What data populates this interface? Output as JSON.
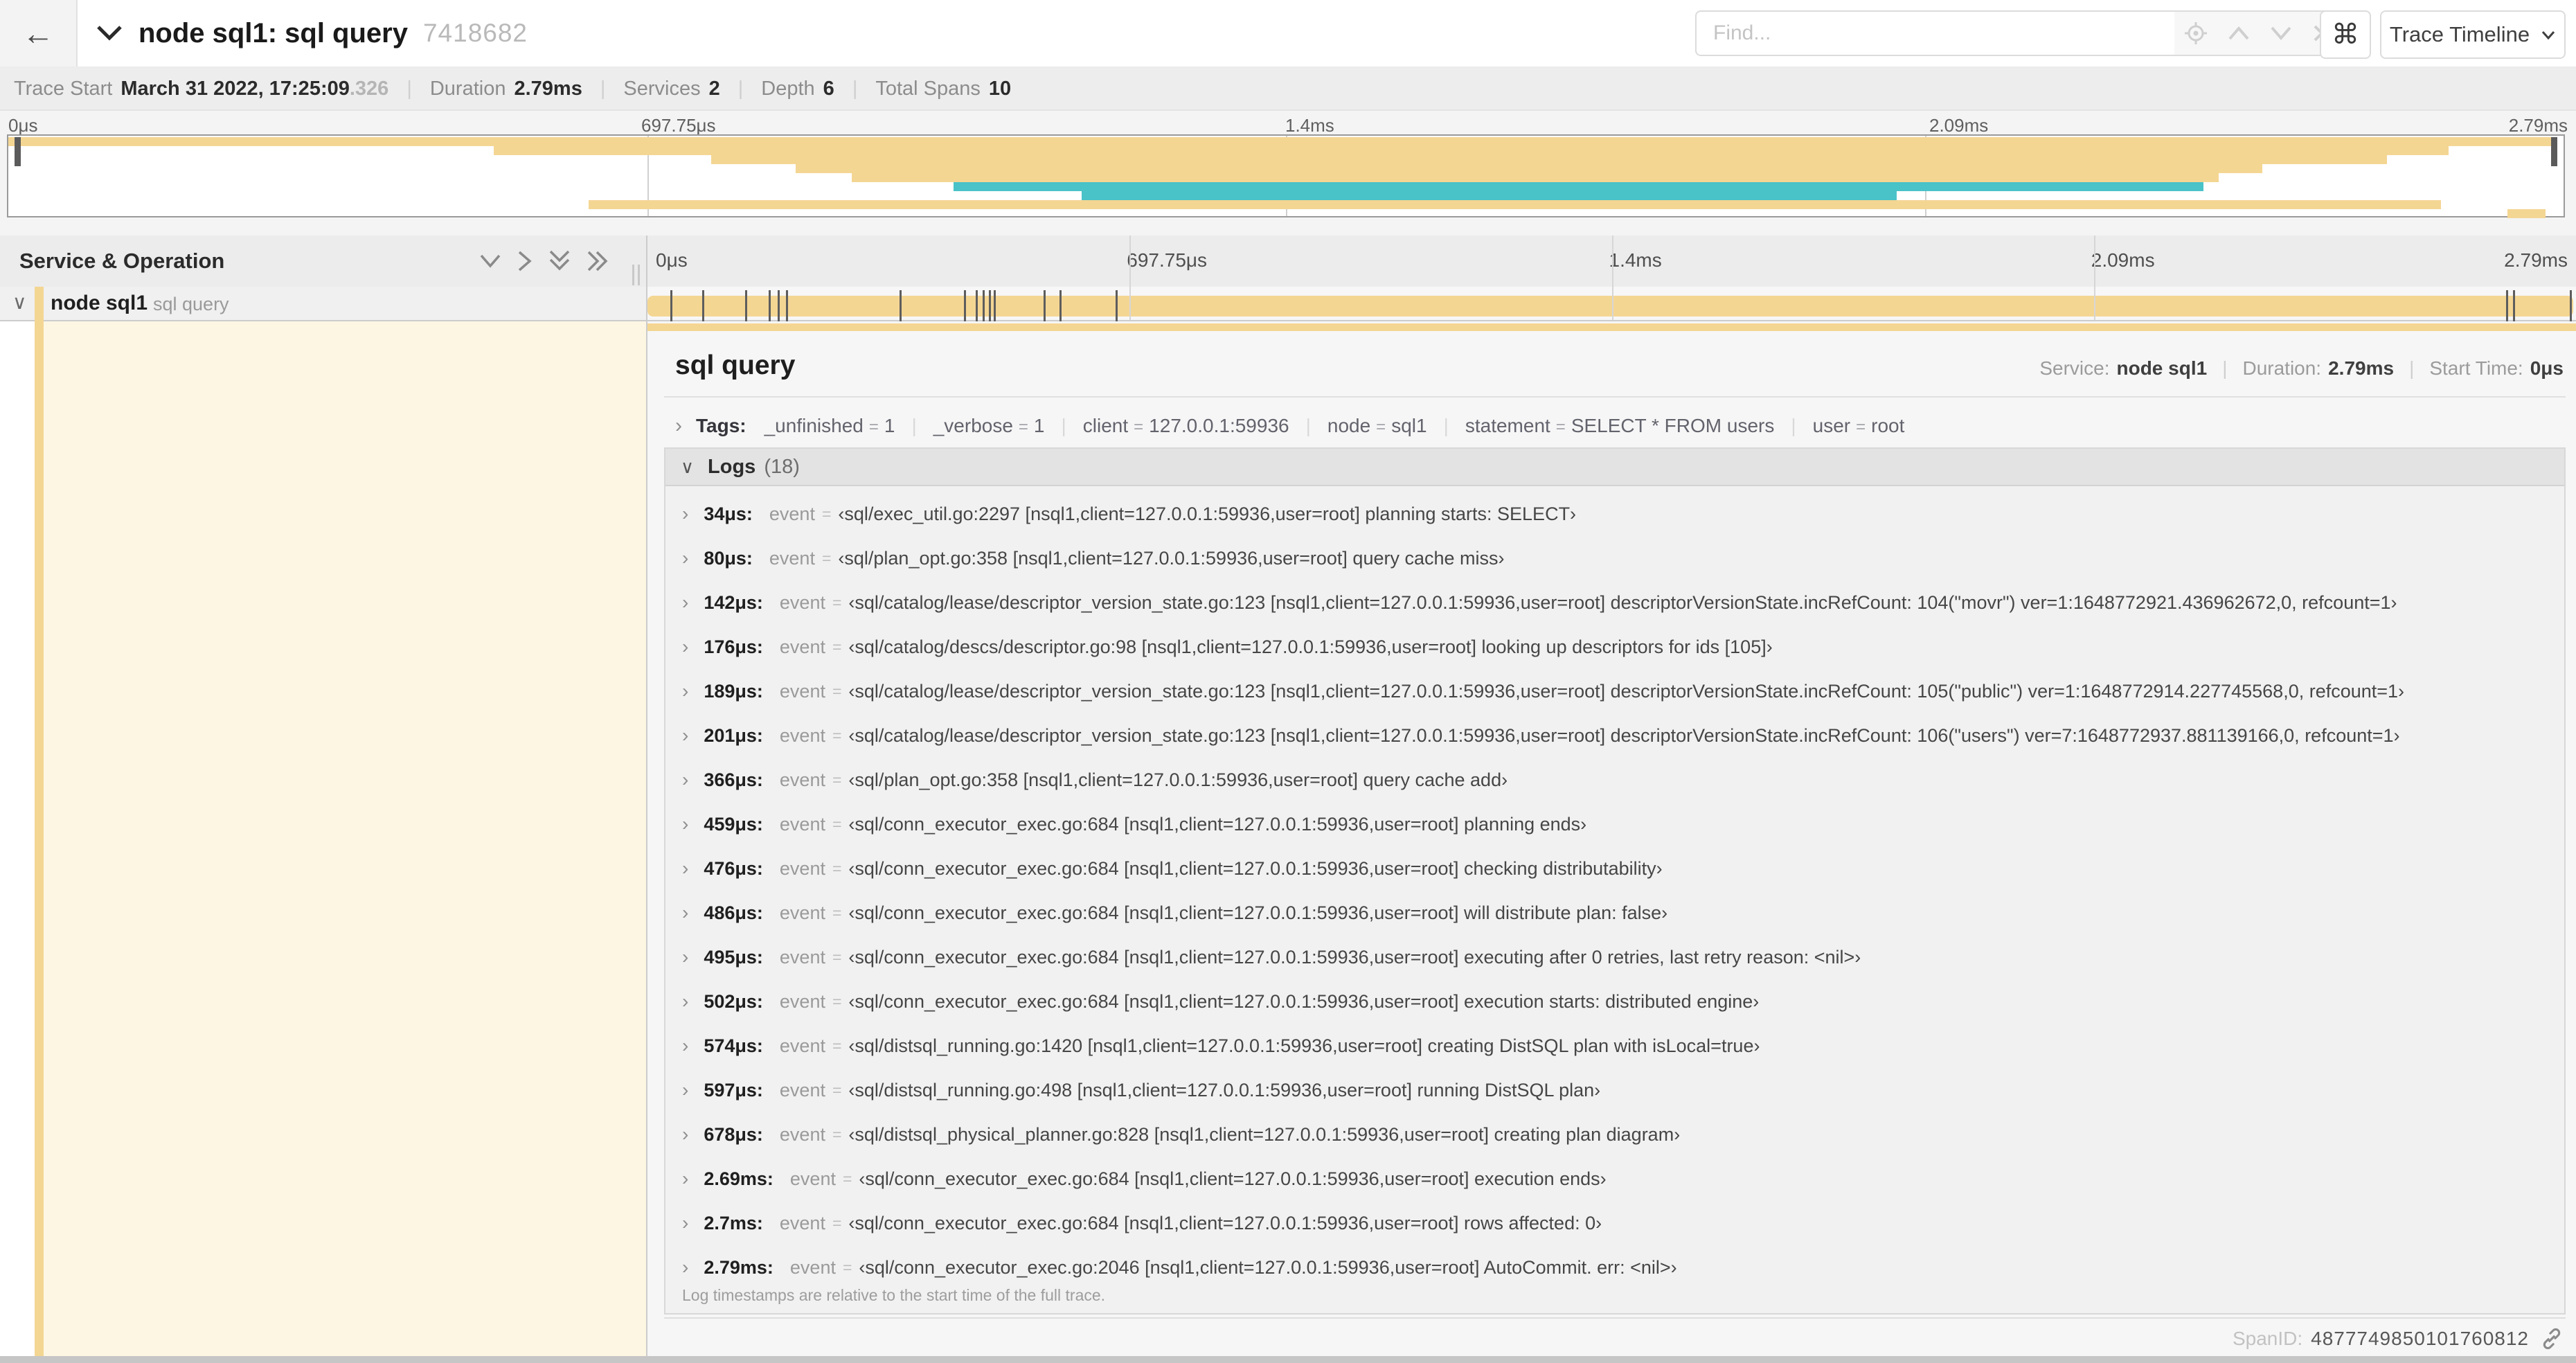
{
  "colors": {
    "accent_tan": "#f4d693",
    "teal": "#49c2c8",
    "cream_bg": "#fdf6e3"
  },
  "topbar": {
    "back_label": "←",
    "collapse_label": "∨",
    "title": "node sql1: sql query",
    "trace_id": "7418682",
    "find_placeholder": "Find...",
    "shortcut_label": "⌘",
    "view_selector": "Trace Timeline"
  },
  "trace_meta": {
    "items": [
      {
        "label": "Trace Start",
        "value": "March 31 2022, 17:25:09",
        "suffix": ".326"
      },
      {
        "label": "Duration",
        "value": "2.79ms"
      },
      {
        "label": "Services",
        "value": "2"
      },
      {
        "label": "Depth",
        "value": "6"
      },
      {
        "label": "Total Spans",
        "value": "10"
      }
    ]
  },
  "timeline": {
    "ticks": [
      "0μs",
      "697.75μs",
      "1.4ms",
      "2.09ms",
      "2.79ms"
    ],
    "duration_us": 2790,
    "gridlines_pct": [
      25,
      50,
      75
    ]
  },
  "minimap": {
    "spans": [
      {
        "r": 0,
        "s": 0,
        "e": 99.7,
        "c": "tan"
      },
      {
        "r": 1,
        "s": 19,
        "e": 95.5,
        "c": "tan"
      },
      {
        "r": 2,
        "s": 27.5,
        "e": 93.1,
        "c": "tan"
      },
      {
        "r": 3,
        "s": 30.8,
        "e": 88.2,
        "c": "tan"
      },
      {
        "r": 4,
        "s": 33,
        "e": 86.5,
        "c": "tan"
      },
      {
        "r": 5,
        "s": 37,
        "e": 85.9,
        "c": "teal"
      },
      {
        "r": 6,
        "s": 42,
        "e": 73.9,
        "c": "teal"
      },
      {
        "r": 7,
        "s": 22.7,
        "e": 95.2,
        "c": "tan"
      },
      {
        "r": 8,
        "s": 97.8,
        "e": 99.3,
        "c": "tan"
      }
    ]
  },
  "left_panel": {
    "header": "Service & Operation",
    "row": {
      "collapse_label": "∨",
      "service": "node sql1",
      "operation": "sql query"
    }
  },
  "span_detail": {
    "title": "sql query",
    "overview": [
      {
        "label": "Service:",
        "value": "node sql1"
      },
      {
        "label": "Duration:",
        "value": "2.79ms"
      },
      {
        "label": "Start Time:",
        "value": "0μs"
      }
    ],
    "tags_chevron": "›",
    "tags_label": "Tags:",
    "tags": [
      {
        "key": "_unfinished",
        "value": "1"
      },
      {
        "key": "_verbose",
        "value": "1"
      },
      {
        "key": "client",
        "value": "127.0.0.1:59936"
      },
      {
        "key": "node",
        "value": "sql1"
      },
      {
        "key": "statement",
        "value": "SELECT * FROM users"
      },
      {
        "key": "user",
        "value": "root"
      }
    ],
    "logs_chevron": "∨",
    "logs_label": "Logs",
    "logs_count": "(18)",
    "logs": [
      {
        "t": "34μs:",
        "us": 34,
        "key": "event",
        "value": "sql/exec_util.go:2297 [nsql1,client=127.0.0.1:59936,user=root] planning starts: SELECT"
      },
      {
        "t": "80μs:",
        "us": 80,
        "key": "event",
        "value": "sql/plan_opt.go:358 [nsql1,client=127.0.0.1:59936,user=root] query cache miss"
      },
      {
        "t": "142μs:",
        "us": 142,
        "key": "event",
        "value": "sql/catalog/lease/descriptor_version_state.go:123 [nsql1,client=127.0.0.1:59936,user=root] descriptorVersionState.incRefCount: 104(\"movr\") ver=1:1648772921.436962672,0, refcount=1"
      },
      {
        "t": "176μs:",
        "us": 176,
        "key": "event",
        "value": "sql/catalog/descs/descriptor.go:98 [nsql1,client=127.0.0.1:59936,user=root] looking up descriptors for ids [105]"
      },
      {
        "t": "189μs:",
        "us": 189,
        "key": "event",
        "value": "sql/catalog/lease/descriptor_version_state.go:123 [nsql1,client=127.0.0.1:59936,user=root] descriptorVersionState.incRefCount: 105(\"public\") ver=1:1648772914.227745568,0, refcount=1"
      },
      {
        "t": "201μs:",
        "us": 201,
        "key": "event",
        "value": "sql/catalog/lease/descriptor_version_state.go:123 [nsql1,client=127.0.0.1:59936,user=root] descriptorVersionState.incRefCount: 106(\"users\") ver=7:1648772937.881139166,0, refcount=1"
      },
      {
        "t": "366μs:",
        "us": 366,
        "key": "event",
        "value": "sql/plan_opt.go:358 [nsql1,client=127.0.0.1:59936,user=root] query cache add"
      },
      {
        "t": "459μs:",
        "us": 459,
        "key": "event",
        "value": "sql/conn_executor_exec.go:684 [nsql1,client=127.0.0.1:59936,user=root] planning ends"
      },
      {
        "t": "476μs:",
        "us": 476,
        "key": "event",
        "value": "sql/conn_executor_exec.go:684 [nsql1,client=127.0.0.1:59936,user=root] checking distributability"
      },
      {
        "t": "486μs:",
        "us": 486,
        "key": "event",
        "value": "sql/conn_executor_exec.go:684 [nsql1,client=127.0.0.1:59936,user=root] will distribute plan: false"
      },
      {
        "t": "495μs:",
        "us": 495,
        "key": "event",
        "value": "sql/conn_executor_exec.go:684 [nsql1,client=127.0.0.1:59936,user=root] executing after 0 retries, last retry reason: <nil>"
      },
      {
        "t": "502μs:",
        "us": 502,
        "key": "event",
        "value": "sql/conn_executor_exec.go:684 [nsql1,client=127.0.0.1:59936,user=root] execution starts: distributed engine"
      },
      {
        "t": "574μs:",
        "us": 574,
        "key": "event",
        "value": "sql/distsql_running.go:1420 [nsql1,client=127.0.0.1:59936,user=root] creating DistSQL plan with isLocal=true"
      },
      {
        "t": "597μs:",
        "us": 597,
        "key": "event",
        "value": "sql/distsql_running.go:498 [nsql1,client=127.0.0.1:59936,user=root] running DistSQL plan"
      },
      {
        "t": "678μs:",
        "us": 678,
        "key": "event",
        "value": "sql/distsql_physical_planner.go:828 [nsql1,client=127.0.0.1:59936,user=root] creating plan diagram"
      },
      {
        "t": "2.69ms:",
        "us": 2690,
        "key": "event",
        "value": "sql/conn_executor_exec.go:684 [nsql1,client=127.0.0.1:59936,user=root] execution ends"
      },
      {
        "t": "2.7ms:",
        "us": 2700,
        "key": "event",
        "value": "sql/conn_executor_exec.go:684 [nsql1,client=127.0.0.1:59936,user=root] rows affected: 0"
      },
      {
        "t": "2.79ms:",
        "us": 2790,
        "key": "event",
        "value": "sql/conn_executor_exec.go:2046 [nsql1,client=127.0.0.1:59936,user=root] AutoCommit. err: <nil>"
      }
    ],
    "logs_footer": "Log timestamps are relative to the start time of the full trace.",
    "span_id_label": "SpanID:",
    "span_id": "4877749850101760812"
  }
}
